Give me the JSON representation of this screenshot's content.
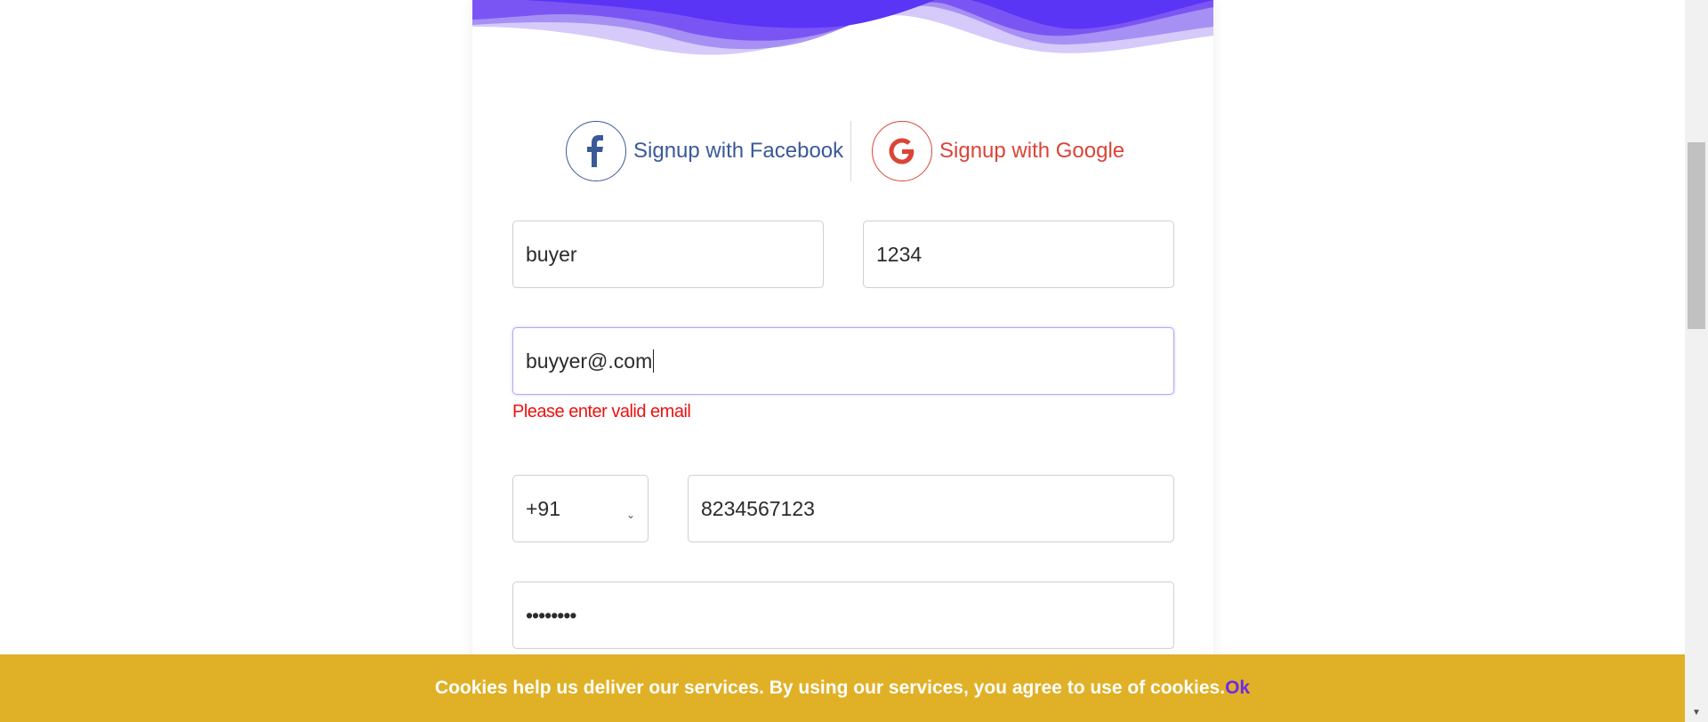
{
  "social": {
    "facebook_label": "Signup with Facebook",
    "google_label": "Signup with Google",
    "facebook_glyph": "f",
    "google_glyph": "G",
    "facebook_color": "#3b5998",
    "google_color": "#db4437"
  },
  "form": {
    "first_name_value": "buyer",
    "last_name_value": "1234",
    "email_value": "buyyer@.com",
    "email_error": "Please enter valid email",
    "country_code_value": "+91",
    "phone_value": "8234567123",
    "password_masked": "••••••••"
  },
  "cookie": {
    "message": "Cookies help us deliver our services. By using our services, you agree to use of cookies.",
    "ok_label": "Ok"
  },
  "colors": {
    "wave_dark": "#5b35f5",
    "wave_light": "#a58cf2",
    "cookie_bg": "#e0b026",
    "error": "#ee1111",
    "accent": "#6a2bea"
  }
}
